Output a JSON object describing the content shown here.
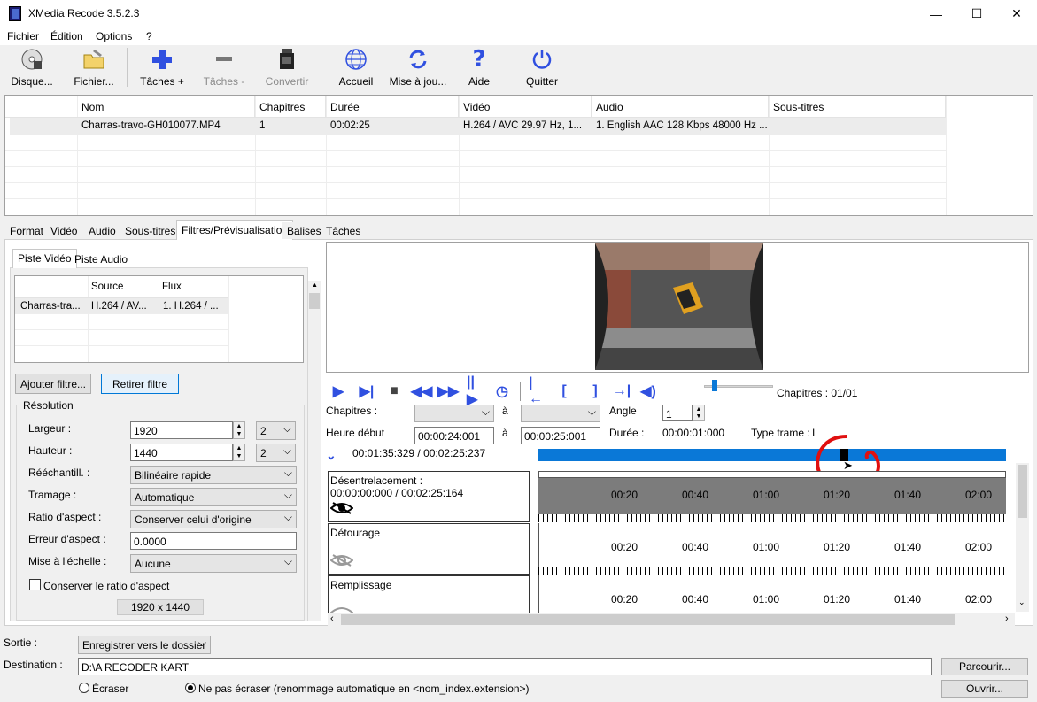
{
  "window": {
    "title": "XMedia Recode 3.5.2.3",
    "minimize": "—",
    "maximize": "☐",
    "close": "✕"
  },
  "menu": [
    "Fichier",
    "Édition",
    "Options",
    "?"
  ],
  "toolbar": {
    "disc": "Disque...",
    "file": "Fichier...",
    "tasks_add": "Tâches +",
    "tasks_remove": "Tâches -",
    "convert": "Convertir",
    "home": "Accueil",
    "update": "Mise à jou...",
    "help": "Aide",
    "quit": "Quitter"
  },
  "filelist": {
    "headers": [
      "Nom",
      "Chapitres",
      "Durée",
      "Vidéo",
      "Audio",
      "Sous-titres"
    ],
    "row": {
      "name": "Charras-travo-GH010077.MP4",
      "chapters": "1",
      "duration": "00:02:25",
      "video": "H.264 / AVC  29.97 Hz, 1...",
      "audio": "1. English AAC  128 Kbps 48000 Hz ...",
      "subs": ""
    }
  },
  "tabs": [
    "Format",
    "Vidéo",
    "Audio",
    "Sous-titres",
    "Filtres/Prévisualisation",
    "Balises",
    "Tâches"
  ],
  "left": {
    "subtabs": [
      "Piste Vidéo",
      "Piste Audio"
    ],
    "stream_headers": [
      "",
      "Source",
      "Flux"
    ],
    "stream_row": [
      "Charras-tra...",
      "H.264 / AV...",
      "1. H.264 / ..."
    ],
    "add_filter": "Ajouter filtre...",
    "remove_filter": "Retirer filtre",
    "group_title": "Résolution",
    "width_label": "Largeur :",
    "width_value": "1920",
    "width_mult": "2",
    "height_label": "Hauteur :",
    "height_value": "1440",
    "height_mult": "2",
    "resample_label": "Rééchantill. :",
    "resample_value": "Bilinéaire rapide",
    "dither_label": "Tramage :",
    "dither_value": "Automatique",
    "aspect_label": "Ratio d'aspect :",
    "aspect_value": "Conserver celui d'origine",
    "aspect_err_label": "Erreur d'aspect :",
    "aspect_err_value": "0.0000",
    "scale_label": "Mise à l'échelle :",
    "scale_value": "Aucune",
    "keep_aspect": "Conserver le ratio d'aspect",
    "res_display": "1920 x 1440"
  },
  "player": {
    "chapters_info": "Chapitres : 01/01",
    "chapters_label": "Chapitres :",
    "a1": "à",
    "angle_label": "Angle",
    "angle_value": "1",
    "start_label": "Heure début",
    "start_value": "00:00:24:001",
    "a2": "à",
    "end_value": "00:00:25:001",
    "duration_label": "Durée :",
    "duration_value": "00:00:01:000",
    "frame_type_label": "Type trame :",
    "frame_type_value": "I",
    "position": "00:01:35:329 / 00:02:25:237"
  },
  "tracks": [
    {
      "name": "Désentrelacement :",
      "time": "00:00:00:000 / 00:02:25:164"
    },
    {
      "name": "Détourage",
      "time": ""
    },
    {
      "name": "Remplissage",
      "time": ""
    }
  ],
  "ruler_labels": [
    "00:20",
    "00:40",
    "01:00",
    "01:20",
    "01:40",
    "02:00"
  ],
  "bottom": {
    "output_label": "Sortie :",
    "output_value": "Enregistrer vers le dossier",
    "dest_label": "Destination :",
    "dest_value": "D:\\A RECODER KART",
    "browse": "Parcourir...",
    "open": "Ouvrir...",
    "overwrite": "Écraser",
    "no_overwrite": "Ne pas écraser (renommage automatique en <nom_index.extension>)"
  },
  "colors": {
    "accent": "#0a78d7",
    "icon_blue": "#3050e0",
    "annotation_red": "#e01010"
  }
}
